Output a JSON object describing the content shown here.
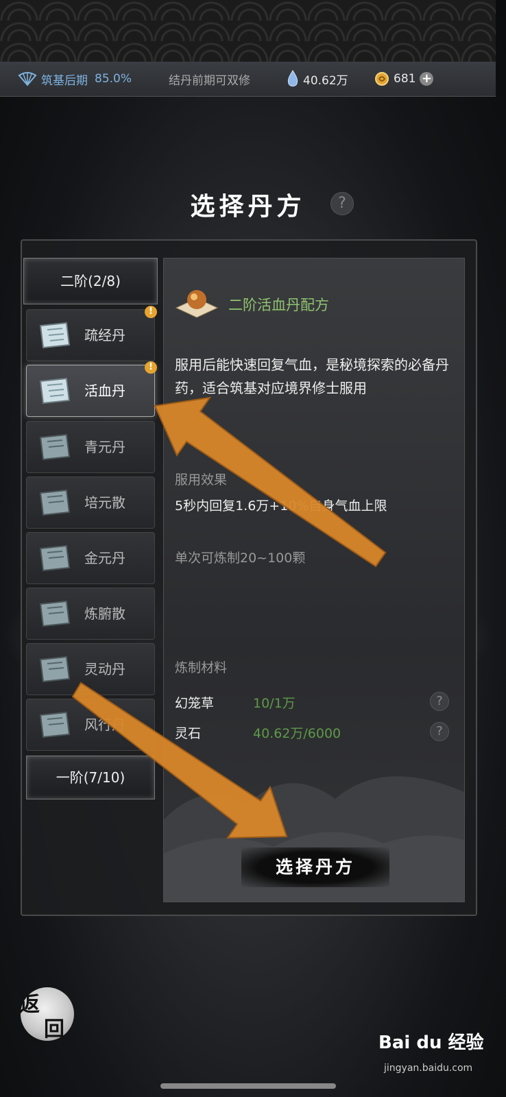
{
  "status_bar": {
    "realm_label": "筑基后期",
    "realm_percent": "85.0%",
    "hint": "结丹前期可双修",
    "spirit_stones": "40.62万",
    "coins": "681",
    "plus_label": "+"
  },
  "page": {
    "title": "选择丹方",
    "help_label": "?"
  },
  "sidebar": {
    "tier2_label": "二阶(2/8)",
    "items": [
      {
        "name": "疏经丹",
        "badge": "!"
      },
      {
        "name": "活血丹",
        "badge": "!"
      },
      {
        "name": "青元丹"
      },
      {
        "name": "培元散"
      },
      {
        "name": "金元丹"
      },
      {
        "name": "炼腑散"
      },
      {
        "name": "灵动丹"
      },
      {
        "name": "风行丹"
      }
    ],
    "tier1_label": "一阶(7/10)"
  },
  "detail": {
    "recipe_title": "二阶活血丹配方",
    "description": "服用后能快速回复气血，是秘境探索的必备丹药，适合筑基对应境界修士服用",
    "effect_label": "服用效果",
    "effect_text": "5秒内回复1.6万+10%自身气血上限",
    "yield_text": "单次可炼制20~100颗",
    "materials_label": "炼制材料",
    "materials": [
      {
        "name": "幻笼草",
        "value": "10/1万"
      },
      {
        "name": "灵石",
        "value": "40.62万/6000"
      }
    ],
    "confirm_button": "选择丹方"
  },
  "footer": {
    "back_char1": "返",
    "back_char2": "回",
    "watermark": "Bai du 经验",
    "watermark_url": "jingyan.baidu.com"
  },
  "colors": {
    "realm_blue": "#7fb3e0",
    "recipe_green": "#8fc46f",
    "material_green": "#5e9a48",
    "badge_orange": "#e6a430",
    "arrow_orange": "#d8872a"
  }
}
